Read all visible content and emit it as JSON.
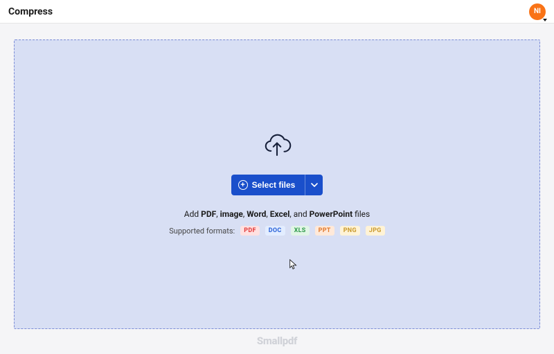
{
  "header": {
    "title": "Compress",
    "avatar_initials": "NI"
  },
  "dropzone": {
    "select_label": "Select files",
    "hint_prefix": "Add ",
    "hint_parts": {
      "pdf": "PDF",
      "sep1": ", ",
      "image": "image",
      "sep2": ", ",
      "word": "Word",
      "sep3": ", ",
      "excel": "Excel",
      "sep4": ", and ",
      "ppt": "PowerPoint",
      "suffix": " files"
    },
    "formats_label": "Supported formats:",
    "formats": {
      "pdf": "PDF",
      "doc": "DOC",
      "xls": "XLS",
      "ppt": "PPT",
      "png": "PNG",
      "jpg": "JPG"
    }
  },
  "footer": {
    "brand": "Smallpdf"
  }
}
